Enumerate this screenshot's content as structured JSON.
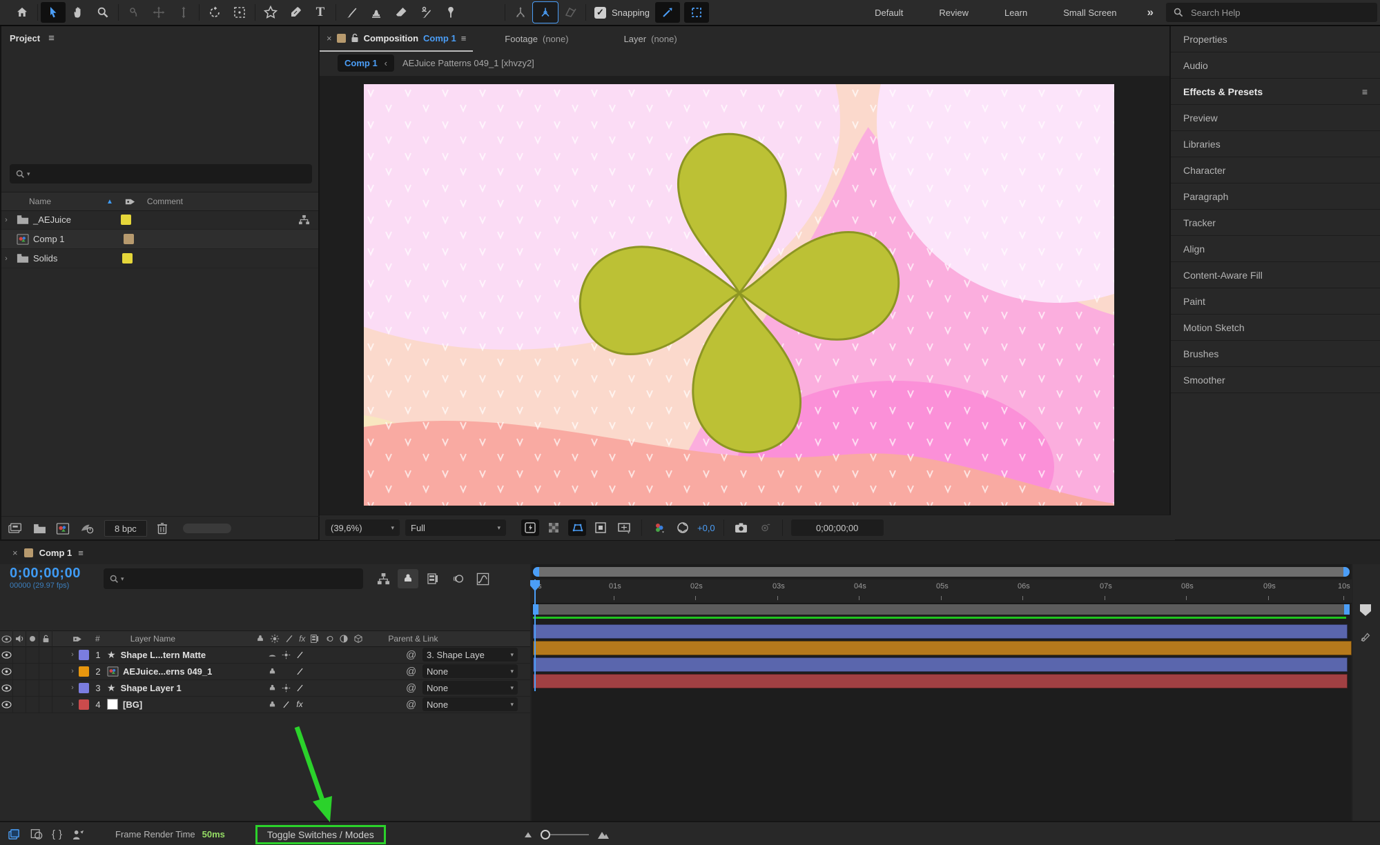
{
  "toolbar": {
    "snapping_label": "Snapping",
    "workspaces": [
      "Default",
      "Review",
      "Learn",
      "Small Screen"
    ],
    "overflow_glyph": "»",
    "help_search_placeholder": "Search Help"
  },
  "project": {
    "title": "Project",
    "menu_glyph": "≡",
    "columns": {
      "name": "Name",
      "comment": "Comment"
    },
    "items": [
      {
        "name": "_AEJuice",
        "type": "folder",
        "label_color": "#e5d63a"
      },
      {
        "name": "Comp 1",
        "type": "composition",
        "label_color": "#b79a6e"
      },
      {
        "name": "Solids",
        "type": "folder",
        "label_color": "#e5d63a"
      }
    ],
    "footer": {
      "bpc_label": "8 bpc"
    }
  },
  "viewer": {
    "close_glyph": "×",
    "menu_glyph": "≡",
    "tabs": [
      {
        "prefix": "Composition",
        "value": "Comp 1"
      },
      {
        "prefix": "Footage",
        "value": "(none)"
      },
      {
        "prefix": "Layer",
        "value": "(none)"
      }
    ],
    "breadcrumb": {
      "current": "Comp 1",
      "separator": "‹",
      "path": "AEJuice Patterns 049_1 [xhvzy2]"
    },
    "controls": {
      "zoom_value": "(39,6%)",
      "resolution": "Full",
      "exposure_value": "+0,0",
      "timecode": "0;00;00;00"
    }
  },
  "right_panel": {
    "menu_glyph": "≡",
    "items": [
      {
        "label": "Properties"
      },
      {
        "label": "Audio"
      },
      {
        "label": "Effects & Presets"
      },
      {
        "label": "Preview"
      },
      {
        "label": "Libraries"
      },
      {
        "label": "Character"
      },
      {
        "label": "Paragraph"
      },
      {
        "label": "Tracker"
      },
      {
        "label": "Align"
      },
      {
        "label": "Content-Aware Fill"
      },
      {
        "label": "Paint"
      },
      {
        "label": "Motion Sketch"
      },
      {
        "label": "Brushes"
      },
      {
        "label": "Smoother"
      }
    ]
  },
  "timeline": {
    "close_glyph": "×",
    "menu_glyph": "≡",
    "tab_label": "Comp 1",
    "timecode": "0;00;00;00",
    "frame_info": "00000 (29.97 fps)",
    "columns": {
      "number": "#",
      "layer_name": "Layer Name",
      "parent": "Parent & Link"
    },
    "layers": [
      {
        "index": "1",
        "name": "Shape L...tern Matte",
        "parent_value": "3. Shape Laye",
        "label_color": "#7b7de0",
        "bar_color": "#5a66ad",
        "kind": "shape"
      },
      {
        "index": "2",
        "name": "AEJuice...erns 049_1",
        "parent_value": "None",
        "label_color": "#e7960e",
        "bar_color": "#b5791c",
        "kind": "composition"
      },
      {
        "index": "3",
        "name": "Shape Layer 1",
        "parent_value": "None",
        "label_color": "#7b7de0",
        "bar_color": "#5a66ad",
        "kind": "shape"
      },
      {
        "index": "4",
        "name": "[BG]",
        "parent_value": "None",
        "label_color": "#cc4b4c",
        "bar_color": "#a14043",
        "kind": "solid"
      }
    ],
    "ruler_labels": [
      "0s",
      "01s",
      "02s",
      "03s",
      "04s",
      "05s",
      "06s",
      "07s",
      "08s",
      "09s",
      "10s"
    ],
    "footer": {
      "frame_render_label": "Frame Render Time",
      "frame_render_value": "50ms",
      "toggle_label": "Toggle Switches / Modes"
    }
  },
  "annotation": {
    "color": "#2bd22b",
    "target": "Toggle Switches / Modes button"
  },
  "colors": {
    "accent_blue": "#4b9ef7",
    "timecode_blue": "#3f9bf4",
    "render_time_green": "#95dd65",
    "progress_line_green": "#1fc41f"
  },
  "canvas_art": {
    "background_base": "#fbd9cc",
    "blob_top_left": "#fbdcf5",
    "circle_top_right": "#fce4fa",
    "wave_pink": "#fbaede",
    "wave_salmon": "#f9aaa2",
    "accent_hot_pink": "#fb90d8",
    "accent_cream": "#f8e7c0",
    "flower_fill": "#bcc135",
    "flower_stroke": "#8d9623",
    "pattern_color": "#ffffff"
  }
}
